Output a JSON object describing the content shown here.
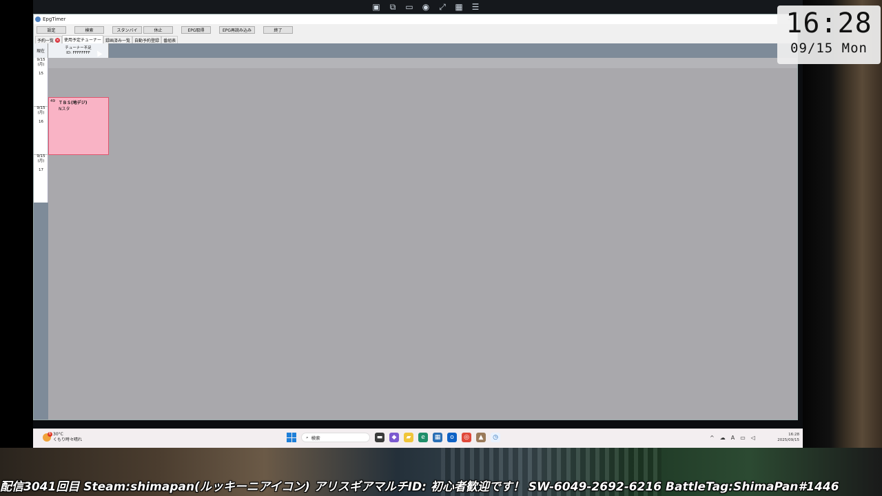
{
  "window": {
    "title": "EpgTimer"
  },
  "toolbar": {
    "buttons": [
      "設定",
      "検索",
      "スタンバイ",
      "休止",
      "EPG取得",
      "EPG再読み込み",
      "終了"
    ]
  },
  "tabs": [
    "予約一覧",
    "使用予定チューナー",
    "録画済み一覧",
    "自動予約登録",
    "番組表"
  ],
  "grid": {
    "now_label": "現在",
    "tuner_header": {
      "line1": "チューナー不足",
      "line2": "ID: FFFFFFFF"
    },
    "time_slots": [
      {
        "date": "9/15",
        "weekday": "(月)",
        "hour": "15"
      },
      {
        "date": "9/15",
        "weekday": "(月)",
        "hour": "16"
      },
      {
        "date": "9/15",
        "weekday": "(月)",
        "hour": "17"
      }
    ],
    "program": {
      "channel_number": "49",
      "channel_name": "ＴＢＳ(地デジ)",
      "title": "Nスタ"
    }
  },
  "taskbar": {
    "weather_temp": "30°C",
    "weather_text": "くもり時々晴れ",
    "weather_badge": "6",
    "search_label": "検索",
    "clock_time": "16:28",
    "clock_date": "2025/09/15"
  },
  "overlay_clock": {
    "time": "16:28",
    "date": "09/15 Mon"
  },
  "stream_caption": "配信3041回目 Steam:shimapan(ルッキーニアイコン) アリスギアマルチID: 初心者歓迎です！ SW-6049-2692-6216 BattleTag:ShimaPan#1446",
  "colors": {
    "program_fill": "#f9b3c5",
    "program_border": "#e0556e",
    "grid_empty": "#a9a8ac",
    "header_bar": "#7e8b99"
  }
}
